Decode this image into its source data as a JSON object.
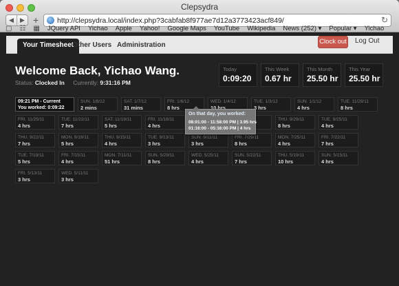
{
  "window": {
    "title": "Clepsydra"
  },
  "browser": {
    "url": "http://clepsydra.local/index.php?3cabfab8f977ae7d12a3773423acf849/",
    "bookmarks": [
      "JQuery API",
      "Yichao",
      "Apple",
      "Yahoo!",
      "Google Maps",
      "YouTube",
      "Wikipedia",
      "News (252)",
      "Popular",
      "Yichao"
    ]
  },
  "nav": {
    "tabs": [
      "Your Timesheet",
      "Other Users",
      "Administration"
    ],
    "clock_out": "Clock out",
    "log_out": "Log Out"
  },
  "welcome": {
    "heading": "Welcome Back, Yichao Wang.",
    "status_label": "Status:",
    "status_value": "Clocked In",
    "currently_label": "Currently:",
    "currently_value": "9:31:16 PM"
  },
  "stats": [
    {
      "label": "Today",
      "value": "0:09:20"
    },
    {
      "label": "This Week",
      "value": "0.67 hr"
    },
    {
      "label": "This Month",
      "value": "25.50 hr"
    },
    {
      "label": "This Year",
      "value": "25.50 hr"
    }
  ],
  "current": {
    "line1": "09:21 PM - Current",
    "line2": "You worked: 0:09:22"
  },
  "days": [
    [
      {
        "date": "SUN. 1/8/12",
        "hours": "2 mins"
      },
      {
        "date": "SAT. 1/7/12",
        "hours": "31 mins"
      },
      {
        "date": "FRI. 1/6/12",
        "hours": "8 hrs"
      },
      {
        "date": "WED. 1/4/12",
        "hours": "10 hrs"
      },
      {
        "date": "TUE. 1/3/12",
        "hours": "3 hrs"
      },
      {
        "date": "SUN. 1/1/12",
        "hours": "4 hrs"
      },
      {
        "date": "TUE. 11/29/11",
        "hours": "8 hrs"
      }
    ],
    [
      {
        "date": "FRI. 11/25/11",
        "hours": "4 hrs"
      },
      {
        "date": "TUE. 11/22/11",
        "hours": "7 hrs"
      },
      {
        "date": "SAT. 11/19/11",
        "hours": "5 hrs"
      },
      {
        "date": "FRI. 11/18/11",
        "hours": "4 hrs"
      },
      {
        "date": "",
        "hours": ""
      },
      {
        "date": "11/5/11",
        "hours": ""
      },
      {
        "date": "THU. 9/29/11",
        "hours": "8 hrs"
      },
      {
        "date": "TUE. 9/25/11",
        "hours": "4 hrs"
      }
    ],
    [
      {
        "date": "THU. 9/22/11",
        "hours": "7 hrs"
      },
      {
        "date": "MON. 9/19/11",
        "hours": "5 hrs"
      },
      {
        "date": "THU. 9/15/11",
        "hours": "4 hrs"
      },
      {
        "date": "TUE. 9/13/11",
        "hours": "3 hrs"
      },
      {
        "date": "SUN. 9/11/11",
        "hours": "3 hrs"
      },
      {
        "date": "FRI. 7/29/11",
        "hours": "8 hrs"
      },
      {
        "date": "MON. 7/25/11",
        "hours": "4 hrs"
      },
      {
        "date": "FRI. 7/22/11",
        "hours": "7 hrs"
      }
    ],
    [
      {
        "date": "TUE. 7/19/11",
        "hours": "5 hrs"
      },
      {
        "date": "FRI. 7/15/11",
        "hours": "4 hrs"
      },
      {
        "date": "MON. 7/11/11",
        "hours": "51 hrs"
      },
      {
        "date": "SUN. 5/29/11",
        "hours": "8 hrs"
      },
      {
        "date": "WED. 5/25/11",
        "hours": "4 hrs"
      },
      {
        "date": "SUN. 5/22/11",
        "hours": "7 hrs"
      },
      {
        "date": "THU. 5/19/11",
        "hours": "10 hrs"
      },
      {
        "date": "SUN. 5/15/11",
        "hours": "4 hrs"
      }
    ],
    [
      {
        "date": "FRI. 5/13/11",
        "hours": "3 hrs"
      },
      {
        "date": "WED. 5/11/11",
        "hours": "3 hrs"
      }
    ]
  ],
  "tooltip": {
    "title": "On that day, you worked:",
    "lines": [
      "08:01:00 - 11:58:00 PM | 3.95 hrs",
      "01:16:00 - 05:16:00 PM | 4 hrs"
    ]
  }
}
